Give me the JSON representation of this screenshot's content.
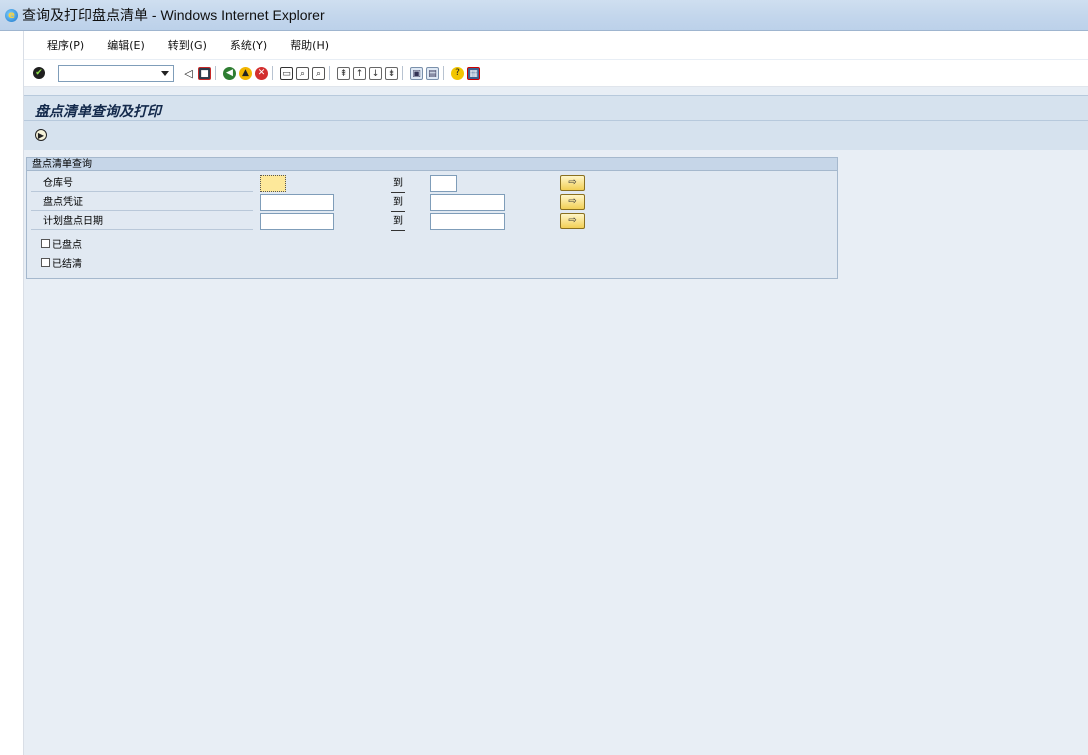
{
  "window": {
    "title": "查询及打印盘点清单 - Windows Internet Explorer",
    "icon": "ie-icon"
  },
  "menu": [
    {
      "label": "程序(P)"
    },
    {
      "label": "编辑(E)"
    },
    {
      "label": "转到(G)"
    },
    {
      "label": "系统(Y)"
    },
    {
      "label": "帮助(H)"
    }
  ],
  "toolbar": {
    "command_field_value": "",
    "icons": [
      "enter-icon",
      "command-dropdown-icon",
      "back-icon",
      "save-icon",
      "green-back-icon",
      "exit-icon",
      "cancel-icon",
      "print-icon",
      "find-icon",
      "find-next-icon",
      "first-page-icon",
      "prev-page-icon",
      "next-page-icon",
      "last-page-icon",
      "new-session-icon",
      "shortcut-icon",
      "help-icon",
      "layout-icon"
    ]
  },
  "header": {
    "title": "盘点清单查询及打印",
    "execute_icon": "execute-icon"
  },
  "group": {
    "title": "盘点清单查询",
    "rows": [
      {
        "label": "仓库号",
        "from": "",
        "to_label": "到",
        "to": ""
      },
      {
        "label": "盘点凭证",
        "from": "",
        "to_label": "到",
        "to": ""
      },
      {
        "label": "计划盘点日期",
        "from": "",
        "to_label": "到",
        "to": ""
      }
    ],
    "checkboxes": [
      {
        "label": "已盘点",
        "checked": false
      },
      {
        "label": "已结清",
        "checked": false
      }
    ]
  },
  "colors": {
    "background": "#e8eef5",
    "header": "#d6e2ee",
    "group_title": "#c6d6e8",
    "focus_field": "#fde89a",
    "multi_button": "#f2cf56"
  }
}
